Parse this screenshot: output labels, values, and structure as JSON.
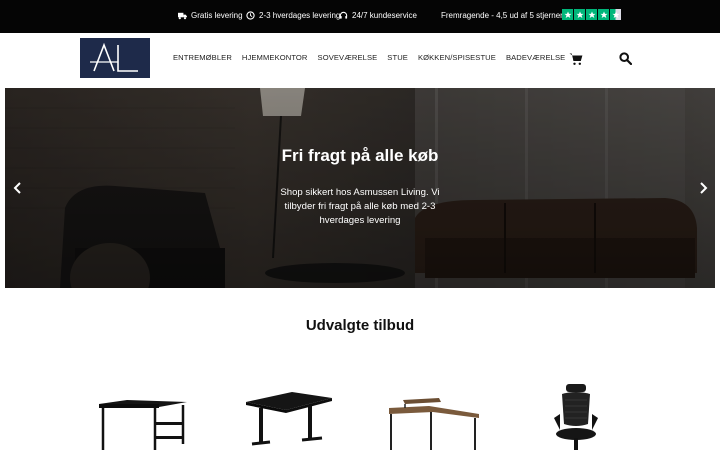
{
  "topbar": {
    "items": [
      {
        "icon": "truck-icon",
        "label": "Gratis levering"
      },
      {
        "icon": "clock-icon",
        "label": "2-3 hverdages levering"
      },
      {
        "icon": "headset-icon",
        "label": "24/7 kundeservice"
      }
    ],
    "rating_text": "Fremragende - 4,5 ud af 5 stjerner",
    "rating_color": "#00b67a"
  },
  "header": {
    "logo_text": "AL",
    "logo_color": "#1e2a4a",
    "nav": [
      "ENTREMØBLER",
      "HJEMMEKONTOR",
      "SOVEVÆRELSE",
      "STUE",
      "KØKKEN/SPISESTUE",
      "BADEVÆRELSE"
    ],
    "cart_icon": "cart-icon",
    "search_icon": "search-icon"
  },
  "hero": {
    "title": "Fri fragt på alle køb",
    "text": "Shop sikkert hos Asmussen Living. Vi tilbyder fri fragt på alle køb med 2-3 hverdages levering"
  },
  "section": {
    "title": "Udvalgte tilbud"
  },
  "products": [
    {
      "name": "black-desk-with-shelves"
    },
    {
      "name": "black-standing-desk"
    },
    {
      "name": "corner-desk-wood"
    },
    {
      "name": "black-office-chair"
    }
  ]
}
